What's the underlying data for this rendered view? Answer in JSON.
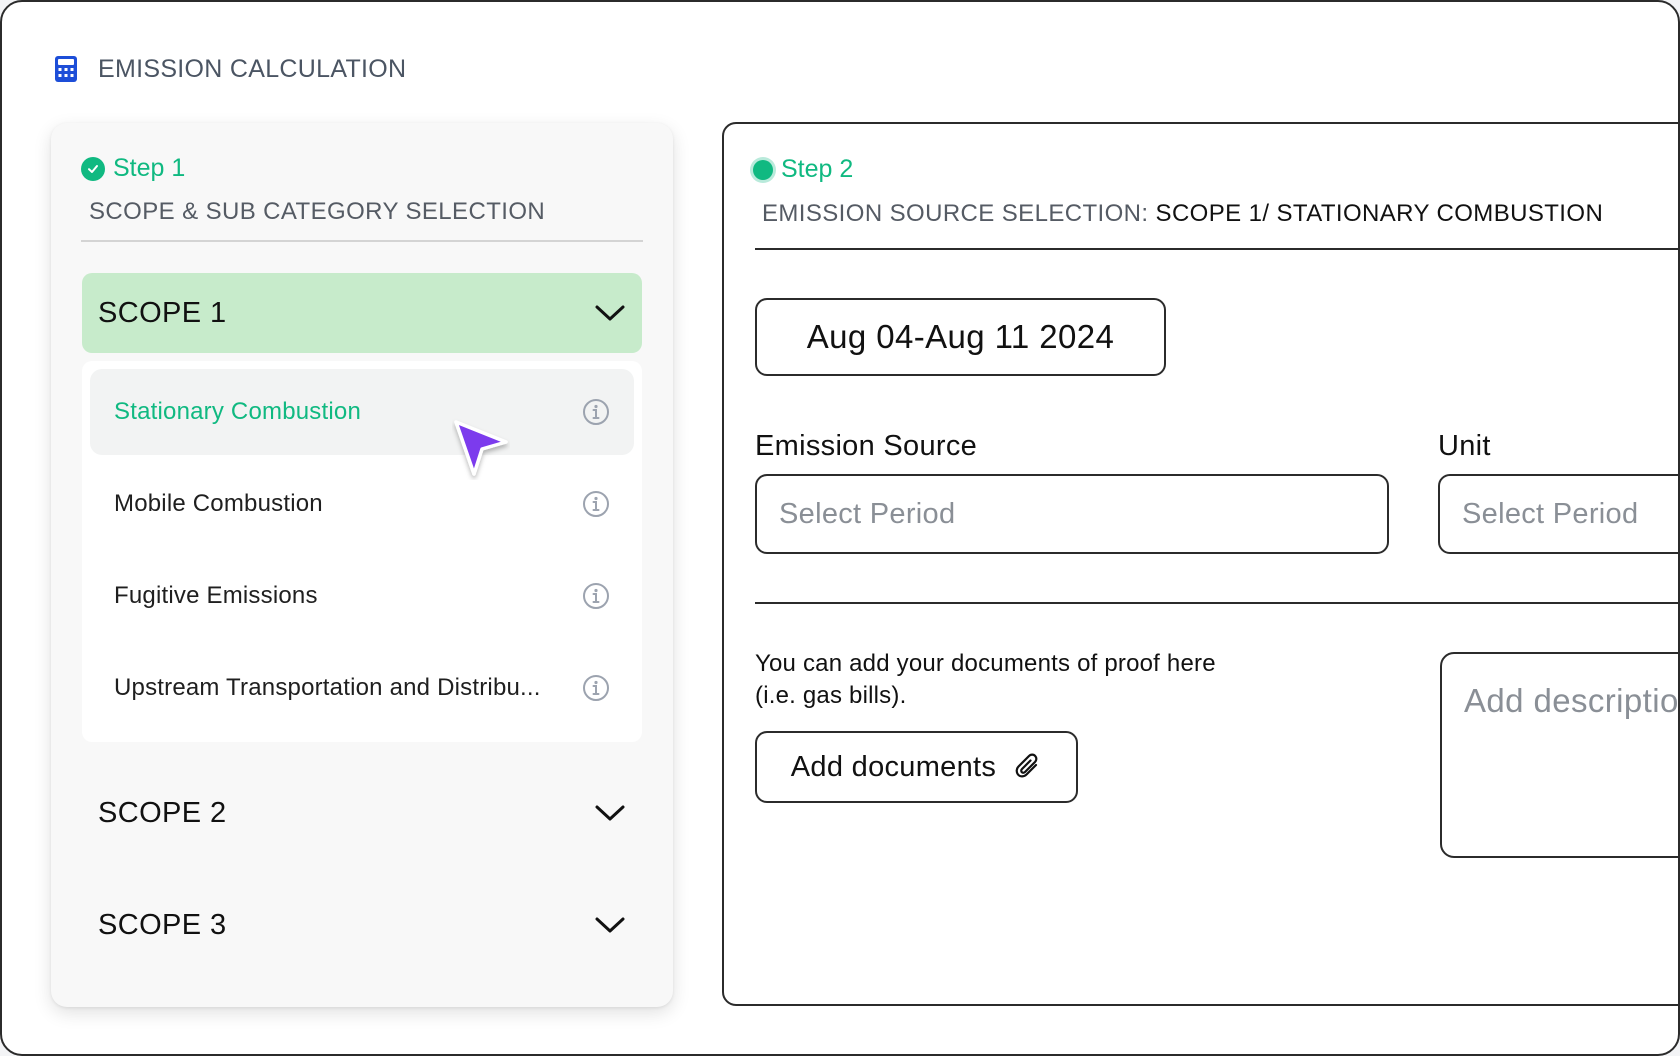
{
  "header": {
    "icon": "calculator-icon",
    "title": "EMISSION CALCULATION",
    "accent_color": "#1d4ed8"
  },
  "step1": {
    "label": "Step 1",
    "status": "completed",
    "subtitle": "SCOPE & SUB CATEGORY SELECTION",
    "scopes": [
      {
        "label": "SCOPE 1",
        "expanded": true,
        "items": [
          {
            "label": "Stationary Combustion",
            "selected": true
          },
          {
            "label": "Mobile Combustion",
            "selected": false
          },
          {
            "label": "Fugitive Emissions",
            "selected": false
          },
          {
            "label": "Upstream Transportation and Distribu...",
            "selected": false
          }
        ]
      },
      {
        "label": "SCOPE 2",
        "expanded": false
      },
      {
        "label": "SCOPE 3",
        "expanded": false
      }
    ]
  },
  "step2": {
    "label": "Step 2",
    "status": "active",
    "source_prefix": "EMISSION SOURCE SELECTION: ",
    "source_value": "SCOPE 1/ STATIONARY COMBUSTION",
    "date_range": "Aug 04-Aug 11 2024",
    "emission_source": {
      "label": "Emission Source",
      "placeholder": "Select Period"
    },
    "unit": {
      "label": "Unit",
      "placeholder": "Select Period"
    },
    "documents": {
      "text_line1": "You can add your documents of proof here",
      "text_line2": "(i.e. gas bills).",
      "button_label": "Add documents",
      "button_icon": "paperclip-icon"
    },
    "description_placeholder": "Add descriptio"
  },
  "colors": {
    "accent_green": "#10b981",
    "active_scope_bg": "#c7ebcb",
    "cursor_purple": "#7c3aed"
  }
}
